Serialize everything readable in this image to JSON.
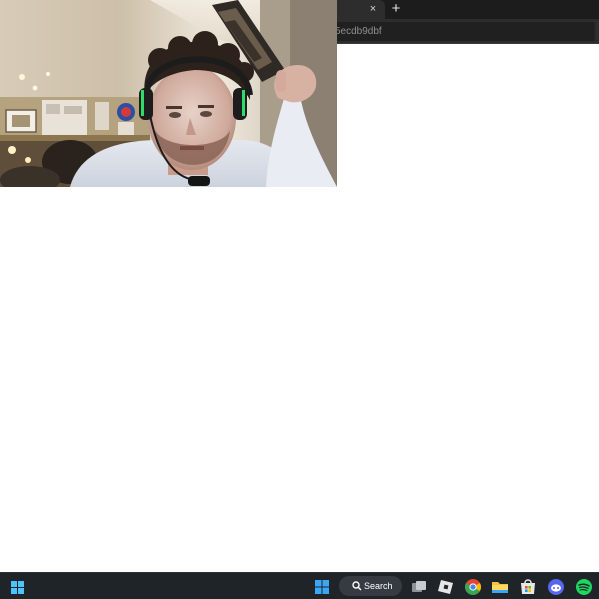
{
  "browser": {
    "tab_close_glyph": "×",
    "new_tab_glyph": "+",
    "address_text": "5ecdb9dbf"
  },
  "webcam": {
    "icon": "webcam-feed"
  },
  "taskbar": {
    "search_label": "Search",
    "apps": [
      {
        "name": "widgets",
        "icon": "windows-logo-icon"
      },
      {
        "name": "start",
        "icon": "windows-start-icon"
      },
      {
        "name": "search",
        "icon": "search-icon"
      },
      {
        "name": "task-view",
        "icon": "task-view-icon"
      },
      {
        "name": "roblox",
        "icon": "roblox-icon"
      },
      {
        "name": "chrome",
        "icon": "chrome-icon"
      },
      {
        "name": "file-explorer",
        "icon": "folder-icon"
      },
      {
        "name": "microsoft-store",
        "icon": "store-icon"
      },
      {
        "name": "discord",
        "icon": "discord-icon"
      },
      {
        "name": "spotify",
        "icon": "spotify-icon"
      }
    ]
  },
  "colors": {
    "taskbar": "#1f2428",
    "browser_frame": "#2d2d2d",
    "page": "#ffffff"
  }
}
